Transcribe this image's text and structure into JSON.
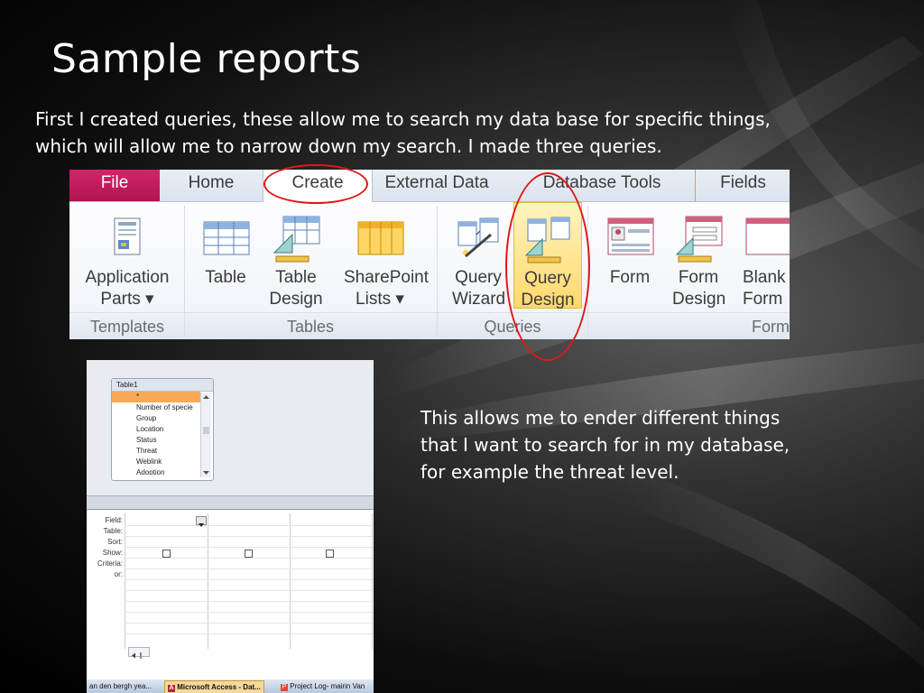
{
  "slide": {
    "title": "Sample reports",
    "intro_line1": "First I created queries, these allow me to search my data base for specific things,",
    "intro_line2": "which will allow me to narrow down my search. I made three queries.",
    "side_text": "This allows me to ender different things that I want to search for in my database, for example the threat level."
  },
  "ribbon": {
    "tabs": [
      "File",
      "Home",
      "Create",
      "External Data",
      "Database Tools",
      "Fields"
    ],
    "commands": {
      "application_parts": "Application Parts ▾",
      "table": "Table",
      "table_design": "Table Design",
      "sharepoint_lists": "SharePoint Lists ▾",
      "query_wizard": "Query Wizard",
      "query_design": "Query Design",
      "form": "Form",
      "form_design": "Form Design",
      "blank_form": "Blank Form"
    },
    "groups": [
      "Templates",
      "Tables",
      "Queries",
      "Form"
    ]
  },
  "query_designer": {
    "table_name": "Table1",
    "fields": [
      "*",
      "Number of specie",
      "Group",
      "Location",
      "Status",
      "Threat",
      "Weblink",
      "Adoption"
    ],
    "grid_rows": [
      "Field:",
      "Table:",
      "Sort:",
      "Show:",
      "Criteria:",
      "or:"
    ],
    "taskbar": [
      "an den bergh yea...",
      "Microsoft Access - Dat...",
      "Project Log- mairin Van"
    ]
  },
  "colors": {
    "file_tab": "#c21b5e",
    "selected_command": "#ffd86b",
    "annotation_circle": "#e01818",
    "highlight_row": "#f7a955"
  }
}
